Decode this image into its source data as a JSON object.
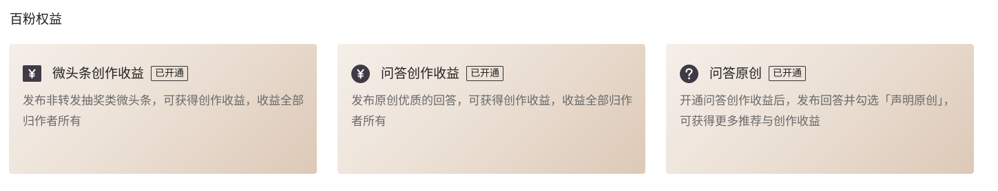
{
  "section": {
    "title": "百粉权益"
  },
  "cards": [
    {
      "icon": "yuan-square-icon",
      "title": "微头条创作收益",
      "badge": "已开通",
      "description": "发布非转发抽奖类微头条，可获得创作收益，收益全部归作者所有"
    },
    {
      "icon": "yuan-circle-icon",
      "title": "问答创作收益",
      "badge": "已开通",
      "description": "发布原创优质的回答，可获得创作收益，收益全部归作者所有"
    },
    {
      "icon": "question-circle-icon",
      "title": "问答原创",
      "badge": "已开通",
      "description": "开通问答创作收益后，发布回答并勾选「声明原创」，可获得更多推荐与创作收益"
    }
  ],
  "colors": {
    "icon_fill": "#3f3a46",
    "card_gradient_start": "#f5efe9",
    "card_gradient_end": "#ddc9b7",
    "description_text": "#6a6a6a"
  }
}
